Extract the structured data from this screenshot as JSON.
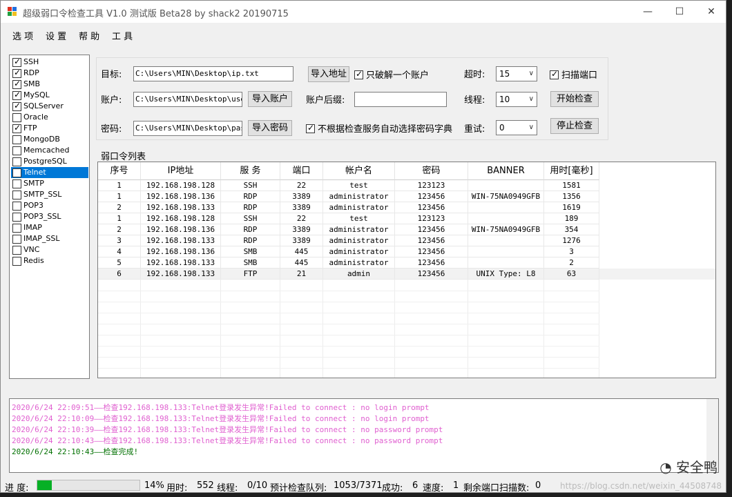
{
  "window": {
    "title": "超级弱口令检查工具 V1.0 测试版 Beta28 by shack2 20190715",
    "min": "—",
    "max": "☐",
    "close": "✕"
  },
  "menu": [
    "选 项",
    "设 置",
    "帮 助",
    "工 具"
  ],
  "services": [
    {
      "label": "SSH",
      "checked": true
    },
    {
      "label": "RDP",
      "checked": true
    },
    {
      "label": "SMB",
      "checked": true
    },
    {
      "label": "MySQL",
      "checked": true
    },
    {
      "label": "SQLServer",
      "checked": true
    },
    {
      "label": "Oracle",
      "checked": false
    },
    {
      "label": "FTP",
      "checked": true
    },
    {
      "label": "MongoDB",
      "checked": false
    },
    {
      "label": "Memcached",
      "checked": false
    },
    {
      "label": "PostgreSQL",
      "checked": false
    },
    {
      "label": "Telnet",
      "checked": false,
      "selected": true
    },
    {
      "label": "SMTP",
      "checked": false
    },
    {
      "label": "SMTP_SSL",
      "checked": false
    },
    {
      "label": "POP3",
      "checked": false
    },
    {
      "label": "POP3_SSL",
      "checked": false
    },
    {
      "label": "IMAP",
      "checked": false
    },
    {
      "label": "IMAP_SSL",
      "checked": false
    },
    {
      "label": "VNC",
      "checked": false
    },
    {
      "label": "Redis",
      "checked": false
    }
  ],
  "config": {
    "target_label": "目标:",
    "target_value": "C:\\Users\\MIN\\Desktop\\ip.txt",
    "account_label": "账户:",
    "account_value": "C:\\Users\\MIN\\Desktop\\usern",
    "password_label": "密码:",
    "password_value": "C:\\Users\\MIN\\Desktop\\passw",
    "import_addr": "导入地址",
    "import_account": "导入账户",
    "import_password": "导入密码",
    "crack_one": "只破解一个账户",
    "suffix_label": "账户后缀:",
    "suffix_value": "",
    "no_auto_dict": "不根据检查服务自动选择密码字典",
    "timeout_label": "超时:",
    "timeout_value": "15",
    "threads_label": "线程:",
    "threads_value": "10",
    "retry_label": "重试:",
    "retry_value": "0",
    "scan_port": "扫描端口",
    "start": "开始检查",
    "stop": "停止检查"
  },
  "grid": {
    "group_label": "弱口令列表",
    "headers": [
      "序号",
      "IP地址",
      "服 务",
      "端口",
      "帐户名",
      "密码",
      "BANNER",
      "用时[毫秒]"
    ],
    "rows": [
      [
        "1",
        "192.168.198.128",
        "SSH",
        "22",
        "test",
        "123123",
        "",
        "1581"
      ],
      [
        "1",
        "192.168.198.136",
        "RDP",
        "3389",
        "administrator",
        "123456",
        "WIN-75NA0949GFB",
        "1356"
      ],
      [
        "2",
        "192.168.198.133",
        "RDP",
        "3389",
        "administrator",
        "123456",
        "",
        "1619"
      ],
      [
        "1",
        "192.168.198.128",
        "SSH",
        "22",
        "test",
        "123123",
        "",
        "189"
      ],
      [
        "2",
        "192.168.198.136",
        "RDP",
        "3389",
        "administrator",
        "123456",
        "WIN-75NA0949GFB",
        "354"
      ],
      [
        "3",
        "192.168.198.133",
        "RDP",
        "3389",
        "administrator",
        "123456",
        "",
        "1276"
      ],
      [
        "4",
        "192.168.198.136",
        "SMB",
        "445",
        "administrator",
        "123456",
        "",
        "3"
      ],
      [
        "5",
        "192.168.198.133",
        "SMB",
        "445",
        "administrator",
        "123456",
        "",
        "2"
      ],
      [
        "6",
        "192.168.198.133",
        "FTP",
        "21",
        "admin",
        "123456",
        "UNIX Type: L8",
        "63"
      ]
    ]
  },
  "log": [
    {
      "text": "2020/6/24 22:09:51——检查192.168.198.133:Telnet登录发生异常!Failed to connect : no login prompt",
      "color": "#e060d0"
    },
    {
      "text": "2020/6/24 22:10:09——检查192.168.198.133:Telnet登录发生异常!Failed to connect : no login prompt",
      "color": "#e060d0"
    },
    {
      "text": "2020/6/24 22:10:39——检查192.168.198.133:Telnet登录发生异常!Failed to connect : no password prompt",
      "color": "#e060d0"
    },
    {
      "text": "2020/6/24 22:10:43——检查192.168.198.133:Telnet登录发生异常!Failed to connect : no password prompt",
      "color": "#e060d0"
    },
    {
      "text": "2020/6/24 22:10:43——检查完成!",
      "color": "#007000"
    }
  ],
  "status": {
    "progress_label": "进 度:",
    "progress_fraction": 0.14,
    "percent": "14%",
    "elapsed_label": "用时:",
    "elapsed": "552",
    "threads_label": "线程:",
    "threads": "0/10",
    "queue_label": "预计检查队列:",
    "queue": "1053/7371",
    "success_label": "成功:",
    "success": "6",
    "speed_label": "速度:",
    "speed": "1",
    "remaining_label": "剩余端口扫描数:",
    "remaining": "0"
  },
  "watermark": {
    "text": "安全鸭",
    "url": "https://blog.csdn.net/weixin_44508748"
  },
  "colors": {
    "progress": "#06b025",
    "selected": "#0078d7",
    "error_log": "#e060d0",
    "done_log": "#007000"
  }
}
